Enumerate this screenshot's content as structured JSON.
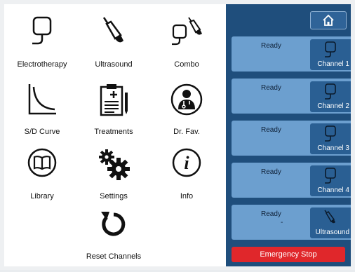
{
  "menu": {
    "electrotherapy": "Electrotherapy",
    "ultrasound": "Ultrasound",
    "combo": "Combo",
    "sd_curve": "S/D Curve",
    "treatments": "Treatments",
    "dr_fav": "Dr. Fav.",
    "library": "Library",
    "settings": "Settings",
    "info": "Info",
    "reset_channels": "Reset Channels"
  },
  "channels": [
    {
      "status": "Ready",
      "label": "Channel 1",
      "icon": "electrode-icon"
    },
    {
      "status": "Ready",
      "label": "Channel 2",
      "icon": "electrode-icon"
    },
    {
      "status": "Ready",
      "label": "Channel 3",
      "icon": "electrode-icon"
    },
    {
      "status": "Ready",
      "label": "Channel 4",
      "icon": "electrode-icon"
    },
    {
      "status": "Ready",
      "extra": "-",
      "label": "Ultrasound",
      "icon": "ultrasound-probe-icon"
    }
  ],
  "emergency_stop": "Emergency Stop",
  "colors": {
    "panel": "#1f4e7c",
    "channel": "#6c9fcf",
    "channel_button": "#2a5f93",
    "emergency": "#e0272b"
  }
}
